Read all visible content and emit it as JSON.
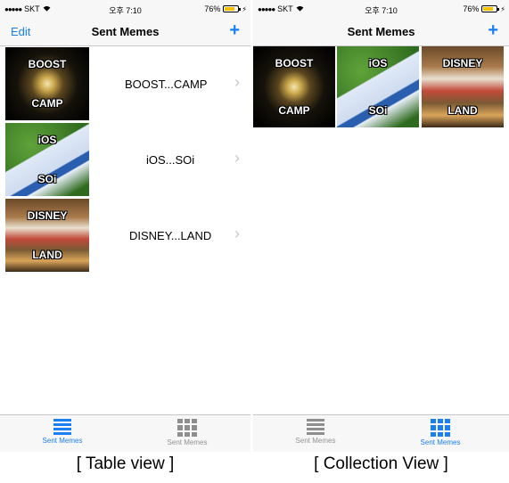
{
  "status": {
    "carrier": "SKT",
    "signal_dots": "●●●●●",
    "time": "오후 7:10",
    "battery": "76%"
  },
  "nav": {
    "title": "Sent Memes",
    "edit_label": "Edit",
    "add_label": "+"
  },
  "memes": [
    {
      "top": "BOOST",
      "bottom": "CAMP",
      "title": "BOOST...CAMP",
      "image": "fireworks"
    },
    {
      "top": "iOS",
      "bottom": "SOi",
      "title": "iOS...SOi",
      "image": "grass"
    },
    {
      "top": "DISNEY",
      "bottom": "LAND",
      "title": "DISNEY...LAND",
      "image": "toys"
    }
  ],
  "tabs": [
    {
      "label": "Sent Memes",
      "icon": "list-icon"
    },
    {
      "label": "Sent Memes",
      "icon": "grid-icon"
    }
  ],
  "captions": {
    "left": "[ Table view ]",
    "right": "[ Collection View ]"
  },
  "colors": {
    "accent": "#1a7ef5",
    "inactive": "#929292"
  }
}
